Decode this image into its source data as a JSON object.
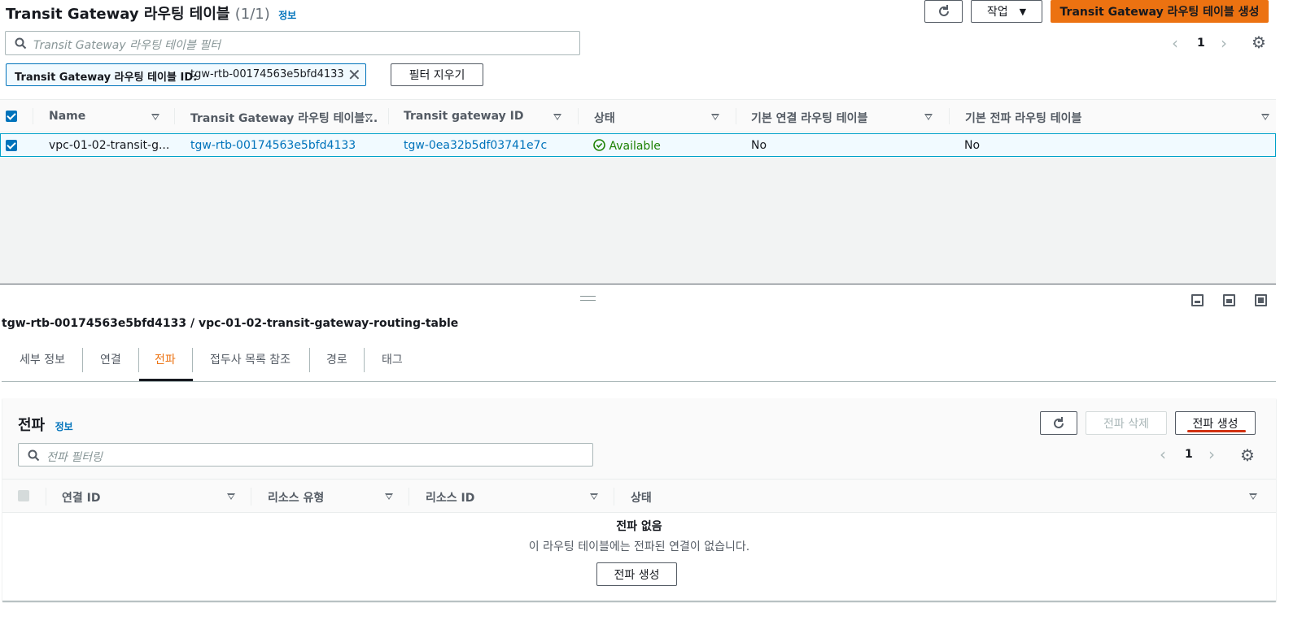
{
  "header": {
    "title": "Transit Gateway 라우팅 테이블",
    "count": "(1/1)",
    "info": "정보",
    "actions_label": "작업",
    "create_label": "Transit Gateway 라우팅 테이블 생성"
  },
  "top_search": {
    "placeholder": "Transit Gateway 라우팅 테이블 필터",
    "page": "1"
  },
  "filter_token": {
    "key": "Transit Gateway 라우팅 테이블 ID:",
    "value": "tgw-rtb-00174563e5bfd4133",
    "clear_label": "필터 지우기"
  },
  "table": {
    "columns": [
      "Name",
      "Transit Gateway 라우팅 테이블...",
      "Transit gateway ID",
      "상태",
      "기본 연결 라우팅 테이블",
      "기본 전파 라우팅 테이블"
    ],
    "rows": [
      {
        "name": "vpc-01-02-transit-g...",
        "rtb_id": "tgw-rtb-00174563e5bfd4133",
        "tgw_id": "tgw-0ea32b5df03741e7c",
        "state": "Available",
        "default_assoc": "No",
        "default_prop": "No"
      }
    ]
  },
  "detail": {
    "title": "tgw-rtb-00174563e5bfd4133 / vpc-01-02-transit-gateway-routing-table",
    "tabs": [
      "세부 정보",
      "연결",
      "전파",
      "접두사 목록 참조",
      "경로",
      "태그"
    ],
    "active_tab": "전파"
  },
  "propagation": {
    "title": "전파",
    "info": "정보",
    "delete_label": "전파 삭제",
    "create_label": "전파 생성",
    "search_placeholder": "전파 필터링",
    "page": "1",
    "columns": [
      "연결 ID",
      "리소스 유형",
      "리소스 ID",
      "상태"
    ],
    "empty_title": "전파 없음",
    "empty_desc": "이 라우팅 테이블에는 전파된 연결이 없습니다.",
    "empty_create_label": "전파 생성"
  },
  "colors": {
    "primary": "#ec7211",
    "link": "#0073bb",
    "success": "#1d8102",
    "active_tab": "#ec7211",
    "annotation": "#d13212"
  }
}
